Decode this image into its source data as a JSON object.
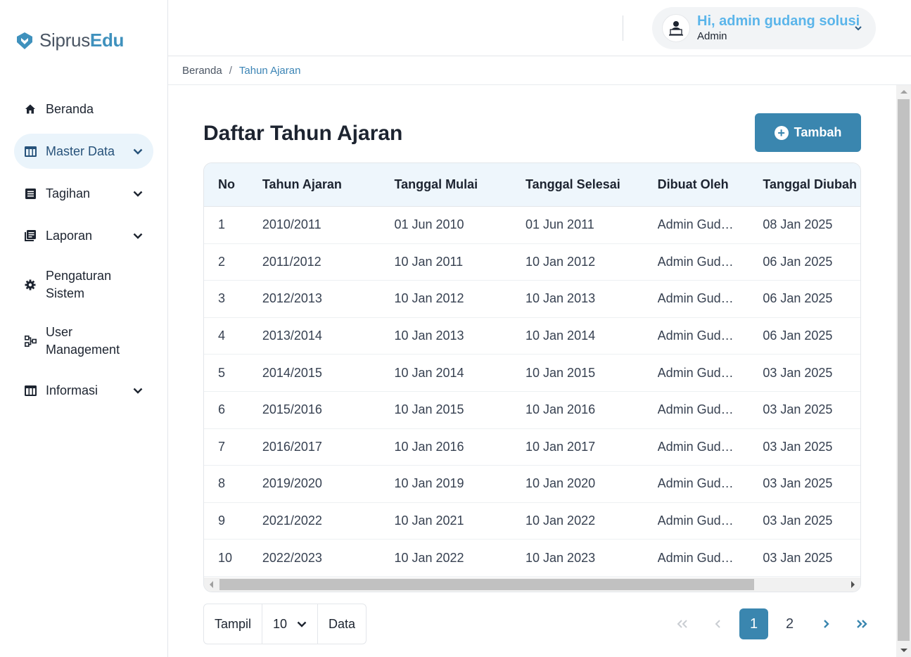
{
  "brand": {
    "name_part1": "Siprus",
    "name_part2": "Edu",
    "accent": "#3f91bd"
  },
  "sidebar": {
    "items": [
      {
        "label": "Beranda",
        "icon": "home-icon",
        "active": false,
        "expandable": false
      },
      {
        "label": "Master Data",
        "icon": "table-icon",
        "active": true,
        "expandable": true
      },
      {
        "label": "Tagihan",
        "icon": "list-box-icon",
        "active": false,
        "expandable": true
      },
      {
        "label": "Laporan",
        "icon": "books-icon",
        "active": false,
        "expandable": true
      },
      {
        "label": "Pengaturan Sistem",
        "icon": "gear-icon",
        "active": false,
        "expandable": false
      },
      {
        "label": "User Management",
        "icon": "hierarchy-icon",
        "active": false,
        "expandable": false
      },
      {
        "label": "Informasi",
        "icon": "table-icon",
        "active": false,
        "expandable": true
      }
    ]
  },
  "header": {
    "greeting": "Hi, admin gudang solusi",
    "role": "Admin"
  },
  "breadcrumb": {
    "home": "Beranda",
    "separator": "/",
    "current": "Tahun Ajaran"
  },
  "main": {
    "title": "Daftar Tahun Ajaran",
    "add_label": "Tambah",
    "columns": [
      "No",
      "Tahun Ajaran",
      "Tanggal Mulai",
      "Tanggal Selesai",
      "Dibuat Oleh",
      "Tanggal Diubah"
    ],
    "rows": [
      [
        "1",
        "2010/2011",
        "01 Jun 2010",
        "01 Jun 2011",
        "Admin Gudang Solusi",
        "08 Jan 2025"
      ],
      [
        "2",
        "2011/2012",
        "10 Jan 2011",
        "10 Jan 2012",
        "Admin Gudang Solusi",
        "06 Jan 2025"
      ],
      [
        "3",
        "2012/2013",
        "10 Jan 2012",
        "10 Jan 2013",
        "Admin Gudang Solusi",
        "06 Jan 2025"
      ],
      [
        "4",
        "2013/2014",
        "10 Jan 2013",
        "10 Jan 2014",
        "Admin Gudang Solusi",
        "06 Jan 2025"
      ],
      [
        "5",
        "2014/2015",
        "10 Jan 2014",
        "10 Jan 2015",
        "Admin Gudang Solusi",
        "03 Jan 2025"
      ],
      [
        "6",
        "2015/2016",
        "10 Jan 2015",
        "10 Jan 2016",
        "Admin Gudang Solusi",
        "03 Jan 2025"
      ],
      [
        "7",
        "2016/2017",
        "10 Jan 2016",
        "10 Jan 2017",
        "Admin Gudang Solusi",
        "03 Jan 2025"
      ],
      [
        "8",
        "2019/2020",
        "10 Jan 2019",
        "10 Jan 2020",
        "Admin Gudang Solusi",
        "03 Jan 2025"
      ],
      [
        "9",
        "2021/2022",
        "10 Jan 2021",
        "10 Jan 2022",
        "Admin Gudang Solusi",
        "03 Jan 2025"
      ],
      [
        "10",
        "2022/2023",
        "10 Jan 2022",
        "10 Jan 2023",
        "Admin Gudang Solusi",
        "03 Jan 2025"
      ]
    ]
  },
  "footer": {
    "show_label": "Tampil",
    "page_size": "10",
    "data_label": "Data",
    "pages": [
      "1",
      "2"
    ],
    "current_page": "1"
  }
}
